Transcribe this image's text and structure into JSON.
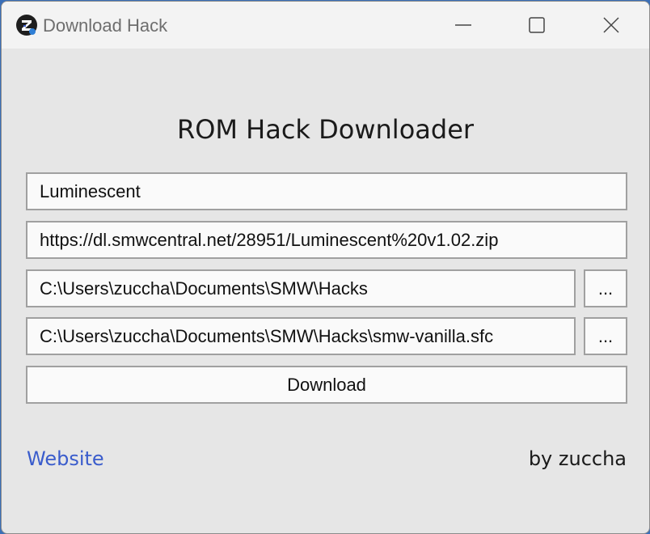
{
  "window": {
    "title": "Download Hack",
    "icon": "z-logo-icon",
    "controls": [
      "minimize-icon",
      "maximize-icon",
      "close-icon"
    ]
  },
  "main": {
    "heading": "ROM Hack Downloader",
    "hack_name": "Luminescent",
    "download_url": "https://dl.smwcentral.net/28951/Luminescent%20v1.02.zip",
    "output_dir": "C:\\Users\\zuccha\\Documents\\SMW\\Hacks",
    "base_rom": "C:\\Users\\zuccha\\Documents\\SMW\\Hacks\\smw-vanilla.sfc",
    "browse_label": "...",
    "download_label": "Download"
  },
  "footer": {
    "website_label": "Website",
    "author": "by zuccha"
  },
  "colors": {
    "link": "#3a5ccc",
    "window_bg": "#e6e6e6",
    "titlebar_bg": "#f3f3f3",
    "desktop": "#3a6fb8"
  }
}
